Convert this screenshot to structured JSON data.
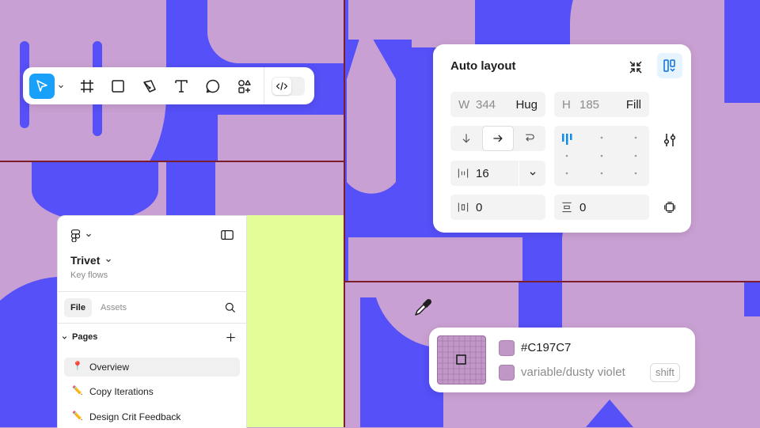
{
  "colors": {
    "blue": "#5550F7",
    "violet": "#C9A0D3",
    "lime": "#E3FD99",
    "guide": "#7A1E2C",
    "accent": "#18A0FB"
  },
  "toolbar": {
    "tools": [
      {
        "icon": "move-icon",
        "active": true
      },
      {
        "icon": "frame-icon"
      },
      {
        "icon": "rectangle-icon"
      },
      {
        "icon": "pen-icon"
      },
      {
        "icon": "text-icon"
      },
      {
        "icon": "comment-icon"
      },
      {
        "icon": "shapes-icon"
      },
      {
        "icon": "code-icon"
      }
    ]
  },
  "auto_layout": {
    "title": "Auto layout",
    "width": {
      "label": "W",
      "value": "344",
      "mode": "Hug"
    },
    "height": {
      "label": "H",
      "value": "185",
      "mode": "Fill"
    },
    "gap": "16",
    "padding_horizontal": "0",
    "padding_vertical": "0"
  },
  "file_panel": {
    "project_name": "Trivet",
    "subtitle": "Key flows",
    "tabs": [
      "File",
      "Assets"
    ],
    "pages_label": "Pages",
    "pages": [
      {
        "icon": "📍",
        "name": "Overview",
        "selected": true
      },
      {
        "icon": "✏️",
        "name": "Copy Iterations"
      },
      {
        "icon": "✏️",
        "name": "Design Crit Feedback"
      }
    ]
  },
  "color_picker": {
    "hex": "#C197C7",
    "variable": "variable/dusty violet",
    "modifier": "shift"
  }
}
